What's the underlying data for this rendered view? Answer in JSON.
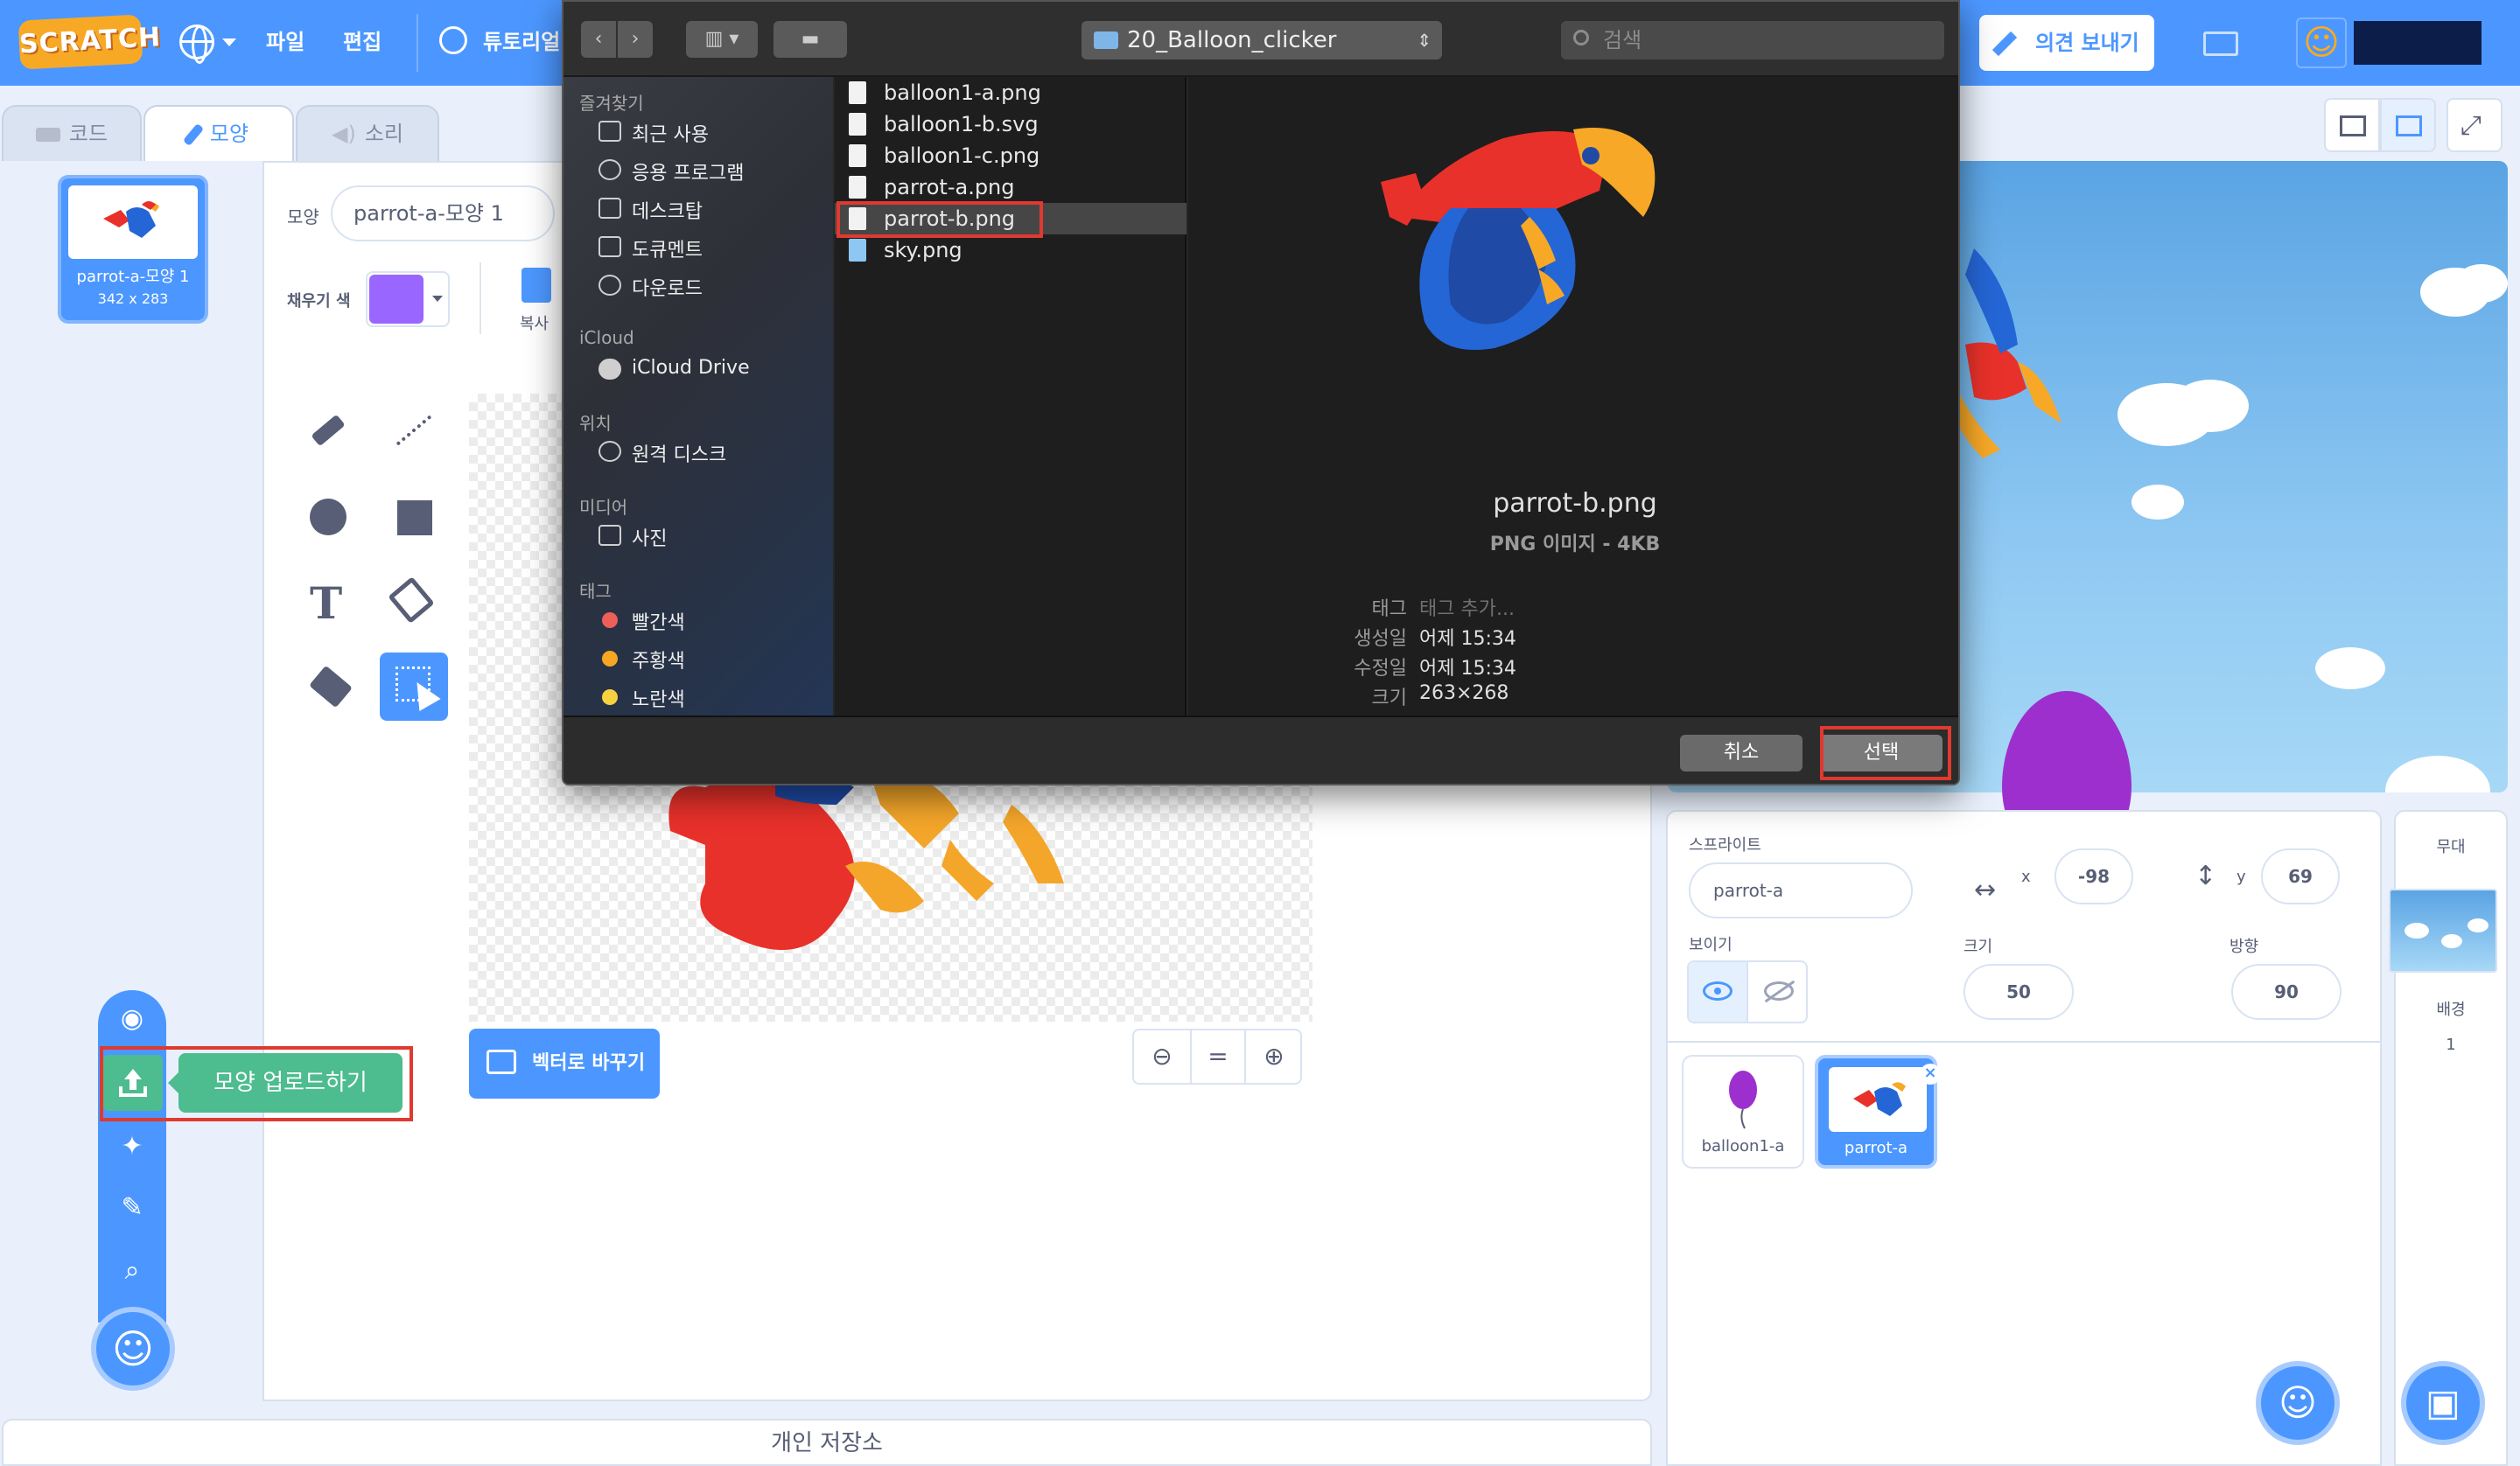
{
  "menubar": {
    "logo": "SCRATCH",
    "file": "파일",
    "edit": "편집",
    "tutorials": "튜토리얼",
    "feedback": "의견 보내기"
  },
  "tabs": {
    "code": "코드",
    "costumes": "모양",
    "sounds": "소리"
  },
  "costume_list": [
    {
      "num": "1",
      "name": "parrot-a-모양 1",
      "size": "342 x 283"
    }
  ],
  "paint": {
    "costume_label": "모양",
    "costume_name": "parrot-a-모양 1",
    "fill_label": "채우기 색",
    "fill_color": "#9966ff",
    "copy_label": "복사",
    "convert_button": "벡터로 바꾸기",
    "zoom_reset": "="
  },
  "costume_menu": {
    "upload_tooltip": "모양 업로드하기"
  },
  "storage_bar": "개인 저장소",
  "sprite_info": {
    "sprite_label": "스프라이트",
    "sprite_name": "parrot-a",
    "x_label": "x",
    "x_value": "-98",
    "y_label": "y",
    "y_value": "69",
    "show_label": "보이기",
    "size_label": "크기",
    "size_value": "50",
    "direction_label": "방향",
    "direction_value": "90"
  },
  "sprites": [
    {
      "name": "balloon1-a",
      "selected": false
    },
    {
      "name": "parrot-a",
      "selected": true
    }
  ],
  "stage_panel": {
    "title": "무대",
    "backdrops_label": "배경",
    "backdrops_count": "1"
  },
  "dialog": {
    "path": "20_Balloon_clicker",
    "search_placeholder": "검색",
    "sidebar": {
      "favorites_head": "즐겨찾기",
      "favorites": [
        "최근 사용",
        "응용 프로그램",
        "데스크탑",
        "도큐멘트",
        "다운로드"
      ],
      "icloud_head": "iCloud",
      "icloud": [
        "iCloud Drive"
      ],
      "locations_head": "위치",
      "locations": [
        "원격 디스크"
      ],
      "media_head": "미디어",
      "media": [
        "사진"
      ],
      "tags_head": "태그",
      "tags": [
        {
          "label": "빨간색",
          "color": "#ee5f57"
        },
        {
          "label": "주황색",
          "color": "#f5a623"
        },
        {
          "label": "노란색",
          "color": "#f8d13f"
        }
      ]
    },
    "files": [
      {
        "name": "balloon1-a.png",
        "selected": false
      },
      {
        "name": "balloon1-b.svg",
        "selected": false
      },
      {
        "name": "balloon1-c.png",
        "selected": false
      },
      {
        "name": "parrot-a.png",
        "selected": false
      },
      {
        "name": "parrot-b.png",
        "selected": true
      },
      {
        "name": "sky.png",
        "selected": false
      }
    ],
    "preview": {
      "name": "parrot-b.png",
      "kind": "PNG 이미지 - 4KB",
      "tags_key": "태그",
      "tags_value": "태그 추가...",
      "created_key": "생성일",
      "created_value": "어제 15:34",
      "modified_key": "수정일",
      "modified_value": "어제 15:34",
      "dimensions_key": "크기",
      "dimensions_value": "263×268"
    },
    "cancel": "취소",
    "choose": "선택"
  },
  "colors": {
    "accent": "#4c97ff",
    "upload_green": "#4dbc8e",
    "highlight_red": "#e0392f"
  }
}
